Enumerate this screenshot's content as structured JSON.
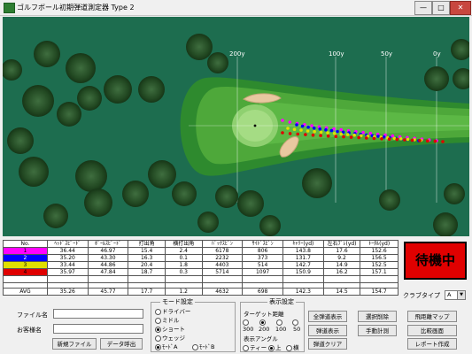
{
  "window": {
    "title": "ゴルフボール初期弾道測定器 Type 2",
    "min_label": "—",
    "max_label": "□",
    "close_label": "✕"
  },
  "field": {
    "distance_labels": [
      "200y",
      "100y",
      "50y",
      "0y"
    ]
  },
  "shot_colors": {
    "1": "#ff00ff",
    "2": "#0000ff",
    "3": "#e0e000",
    "4": "#e00000"
  },
  "table": {
    "headers": [
      "No.",
      "ﾍｯﾄﾞｽﾋﾟｰﾄﾞ",
      "ﾎﾞｰﾙｽﾋﾟｰﾄﾞ",
      "打出角",
      "横打出角",
      "ﾊﾞｯｸｽﾋﾟﾝ",
      "ｻｲﾄﾞｽﾋﾟﾝ",
      "ｷｬﾘｰ(yd)",
      "左右ﾌﾞﾚ(yd)",
      "ﾄｰﾀﾙ(yd)"
    ],
    "rows": [
      {
        "no": "1",
        "values": [
          "36.44",
          "46.97",
          "15.4",
          "2.4",
          "6178",
          "806",
          "143.8",
          "17.6",
          "152.6"
        ]
      },
      {
        "no": "2",
        "values": [
          "35.20",
          "43.30",
          "16.3",
          "0.1",
          "2232",
          "373",
          "131.7",
          "9.2",
          "156.5"
        ]
      },
      {
        "no": "3",
        "values": [
          "33.44",
          "44.86",
          "20.4",
          "1.8",
          "4403",
          "514",
          "142.7",
          "14.9",
          "152.5"
        ]
      },
      {
        "no": "4",
        "values": [
          "35.97",
          "47.84",
          "18.7",
          "0.3",
          "5714",
          "1097",
          "150.9",
          "16.2",
          "157.1"
        ]
      }
    ],
    "avg": {
      "label": "AVG",
      "values": [
        "35.26",
        "45.77",
        "17.7",
        "1.2",
        "4632",
        "698",
        "142.3",
        "14.5",
        "154.7"
      ]
    }
  },
  "status": {
    "label": "待機中",
    "color": "#e00000"
  },
  "club_type": {
    "label": "クラブタイプ",
    "value": "A"
  },
  "form": {
    "file_name_label": "ファイル名",
    "file_name_value": "",
    "customer_label": "お客様名",
    "customer_value": "",
    "new_file_button": "新規ファイル",
    "load_data_button": "データ呼出"
  },
  "mode": {
    "title": "モード設定",
    "options": [
      {
        "label": "ドライバー",
        "selected": false
      },
      {
        "label": "ミドル",
        "selected": false
      },
      {
        "label": "ショート",
        "selected": true
      },
      {
        "label": "ウェッジ",
        "selected": false
      },
      {
        "label": "ﾓｰﾄﾞA",
        "selected": true
      },
      {
        "label": "ﾓｰﾄﾞB",
        "selected": false
      }
    ]
  },
  "display": {
    "title": "表示設定",
    "target_label": "ターゲット距離",
    "target_options": [
      {
        "label": "300",
        "selected": false
      },
      {
        "label": "200",
        "selected": true
      },
      {
        "label": "100",
        "selected": false
      },
      {
        "label": "50",
        "selected": false
      }
    ],
    "angle_label": "表示アングル",
    "angle_options": [
      {
        "label": "ティー",
        "selected": false
      },
      {
        "label": "上",
        "selected": true
      },
      {
        "label": "横",
        "selected": false
      }
    ]
  },
  "buttons": {
    "all_shots": "全弾道表示",
    "shot_display": "弾道表示",
    "shot_clear": "弾道クリア",
    "delete_selected": "選択削除",
    "manual_measure": "手動計測",
    "distance_map": "飛距離マップ",
    "compare_screen": "比較画面",
    "create_report": "レポート作成"
  }
}
